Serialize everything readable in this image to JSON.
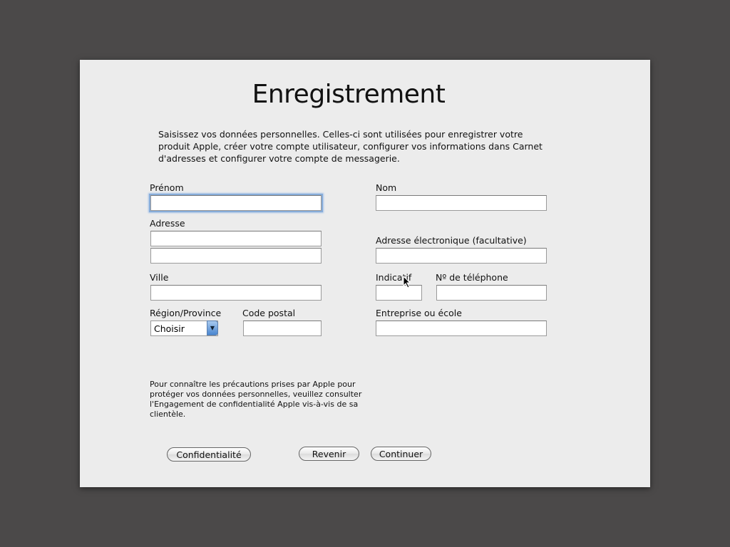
{
  "title": "Enregistrement",
  "intro": "Saisissez vos données personnelles. Celles-ci sont utilisées pour enregistrer votre produit Apple, créer votre compte utilisateur, configurer vos informations dans Carnet d'adresses et configurer votre compte de messagerie.",
  "fields": {
    "prenom": "Prénom",
    "nom": "Nom",
    "adresse": "Adresse",
    "email": "Adresse électronique (facultative)",
    "ville": "Ville",
    "indicatif": "Indicatif",
    "telephone": "Nº de téléphone",
    "region": "Région/Province",
    "region_value": "Choisir",
    "code_postal": "Code postal",
    "entreprise": "Entreprise ou école"
  },
  "privacy_text": "Pour connaître les précautions prises par Apple pour protéger vos données personnelles, veuillez consulter l'Engagement de confidentialité Apple vis-à-vis de sa clientèle.",
  "buttons": {
    "privacy": "Confidentialité",
    "back": "Revenir",
    "continue": "Continuer"
  }
}
